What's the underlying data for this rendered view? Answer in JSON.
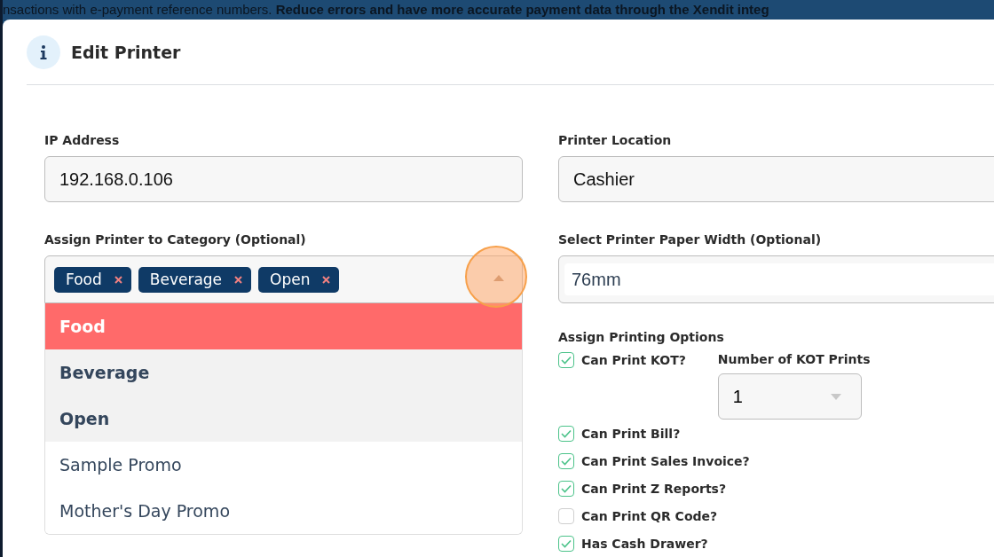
{
  "banner": {
    "text": "nsactions with e-payment reference numbers. **Reduce errors and have more accurate payment data through the Xendit integ**"
  },
  "dialog": {
    "title": "Edit Printer"
  },
  "ip_address": {
    "label": "IP Address",
    "value": "192.168.0.106"
  },
  "category": {
    "label": "Assign Printer to Category (Optional)",
    "tags": [
      "Food",
      "Beverage",
      "Open"
    ],
    "expanded": true,
    "options": [
      {
        "label": "Food",
        "selected": true,
        "highlighted": true
      },
      {
        "label": "Beverage",
        "selected": true,
        "highlighted": false
      },
      {
        "label": "Open",
        "selected": true,
        "highlighted": false
      },
      {
        "label": "Sample Promo",
        "selected": false,
        "highlighted": false
      },
      {
        "label": "Mother's Day Promo",
        "selected": false,
        "highlighted": false
      }
    ]
  },
  "printer_location": {
    "label": "Printer Location",
    "value": "Cashier"
  },
  "paper_width": {
    "label": "Select Printer Paper Width (Optional)",
    "value": "76mm"
  },
  "printing_options": {
    "label": "Assign Printing Options",
    "kot_prints": {
      "label": "Number of KOT Prints",
      "value": "1"
    },
    "options": [
      {
        "label": "Can Print KOT?",
        "checked": true
      },
      {
        "label": "Can Print Bill?",
        "checked": true
      },
      {
        "label": "Can Print Sales Invoice?",
        "checked": true
      },
      {
        "label": "Can Print Z Reports?",
        "checked": true
      },
      {
        "label": "Can Print QR Code?",
        "checked": false
      },
      {
        "label": "Has Cash Drawer?",
        "checked": true
      }
    ]
  }
}
